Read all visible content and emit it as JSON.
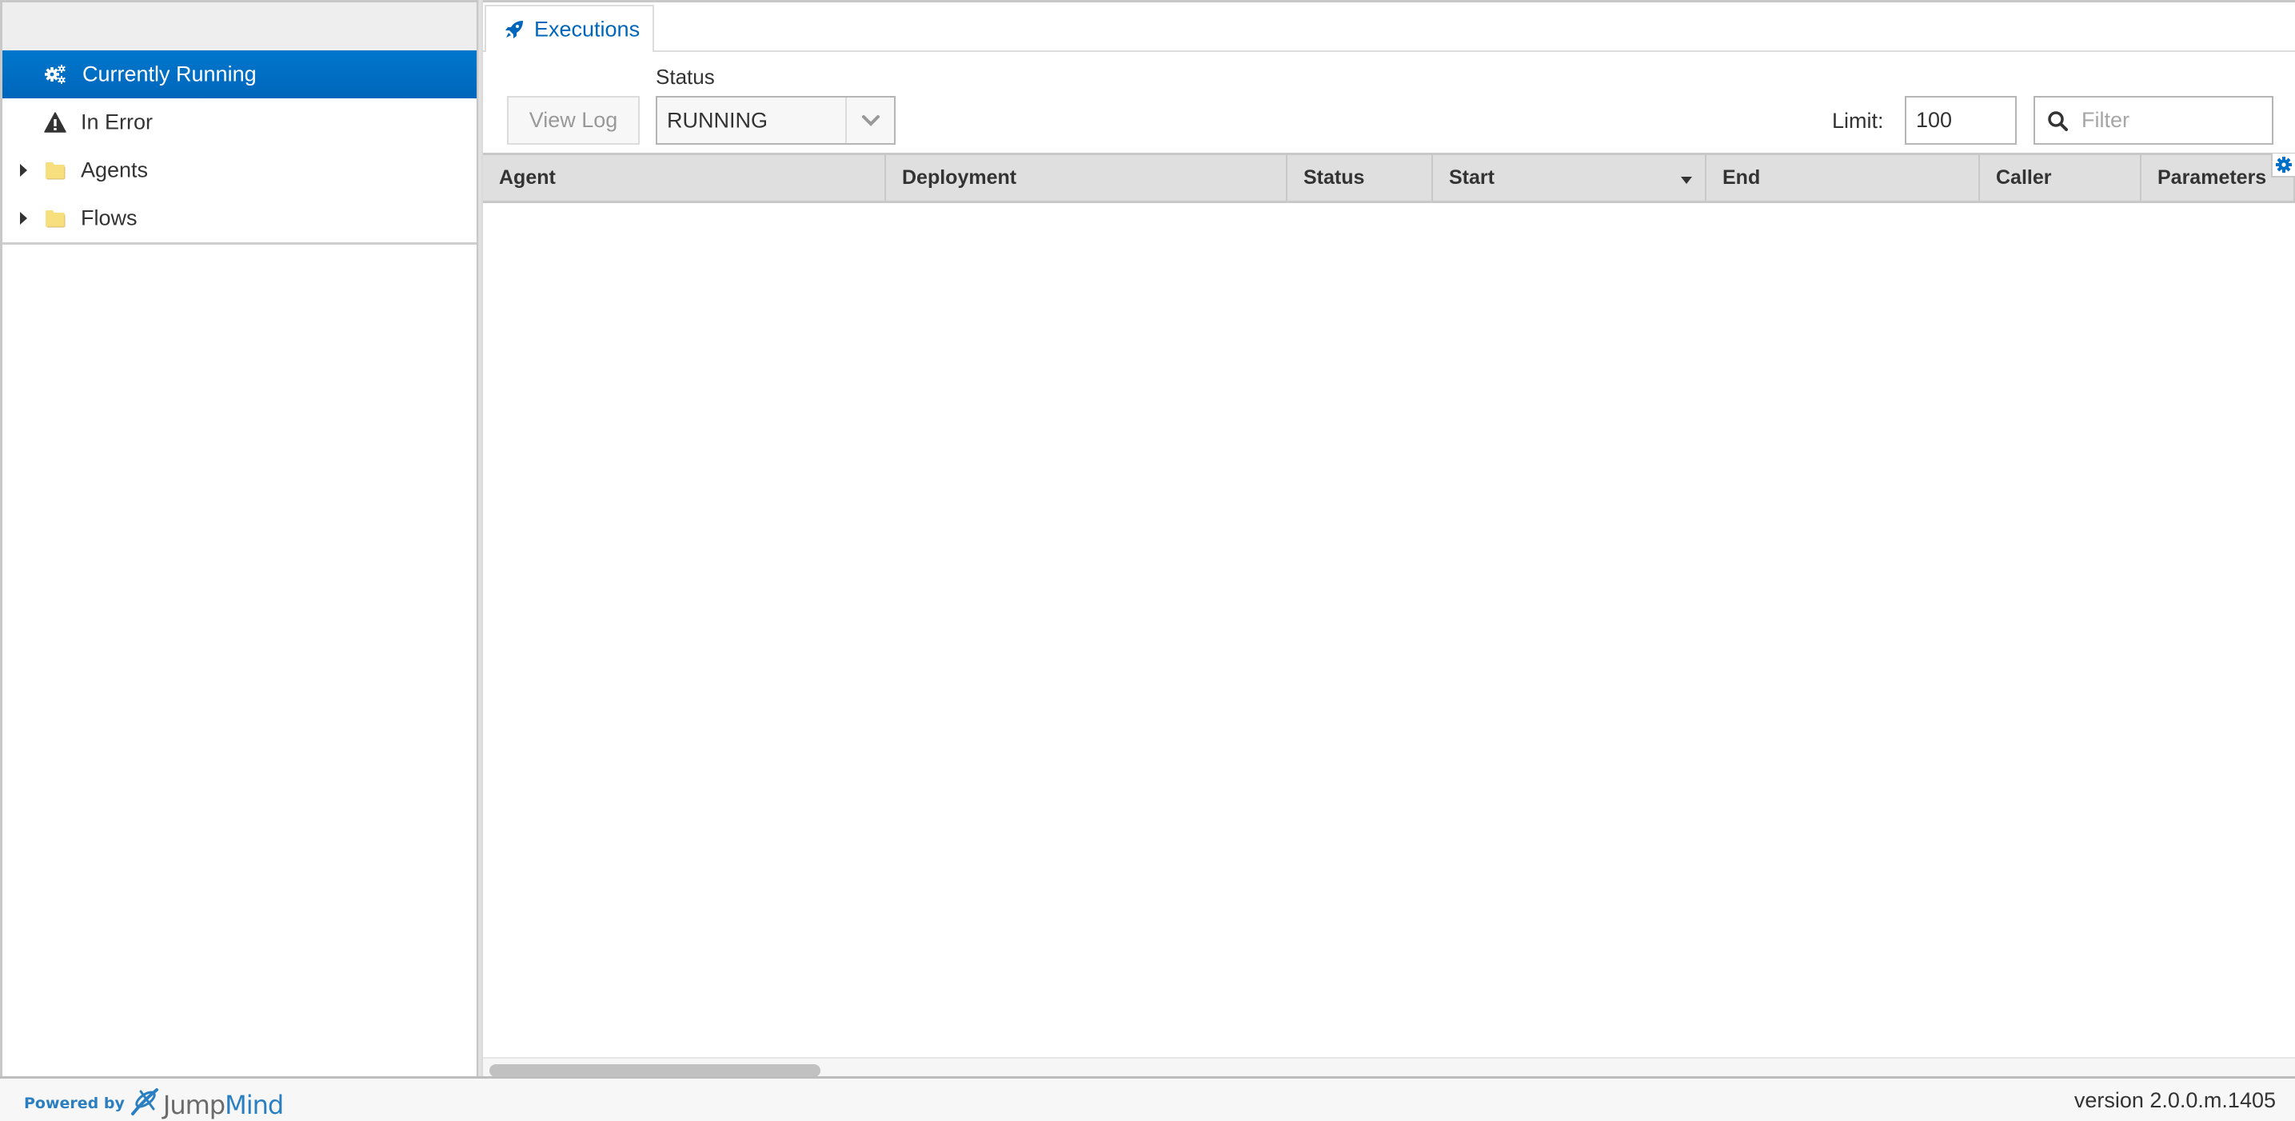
{
  "sidebar": {
    "items": [
      {
        "label": "Currently Running",
        "icon": "gears-icon",
        "selected": true,
        "expandable": false
      },
      {
        "label": "In Error",
        "icon": "warning-icon",
        "selected": false,
        "expandable": false
      },
      {
        "label": "Agents",
        "icon": "folder-icon",
        "selected": false,
        "expandable": true
      },
      {
        "label": "Flows",
        "icon": "folder-icon",
        "selected": false,
        "expandable": true
      }
    ]
  },
  "main": {
    "tabs": [
      {
        "label": "Executions",
        "icon": "rocket-icon",
        "active": true
      }
    ],
    "toolbar": {
      "view_log_label": "View Log",
      "status_caption": "Status",
      "status_value": "RUNNING",
      "limit_label": "Limit:",
      "limit_value": "100",
      "filter_placeholder": "Filter",
      "filter_value": ""
    },
    "grid": {
      "columns": [
        {
          "label": "Agent"
        },
        {
          "label": "Deployment"
        },
        {
          "label": "Status"
        },
        {
          "label": "Start",
          "sorted": "descending"
        },
        {
          "label": "End"
        },
        {
          "label": "Caller"
        },
        {
          "label": "Parameters"
        }
      ],
      "rows": []
    }
  },
  "footer": {
    "powered_by": "Powered by",
    "brand_part1": "Jump",
    "brand_part2": "Mind",
    "version": "version 2.0.0.m.1405"
  },
  "colors": {
    "accent": "#0066bb",
    "selected_bg": "#0070c6",
    "folder": "#f8df7e",
    "header_bg": "#dfdfdf",
    "brand_blue": "#2b7fc1"
  }
}
